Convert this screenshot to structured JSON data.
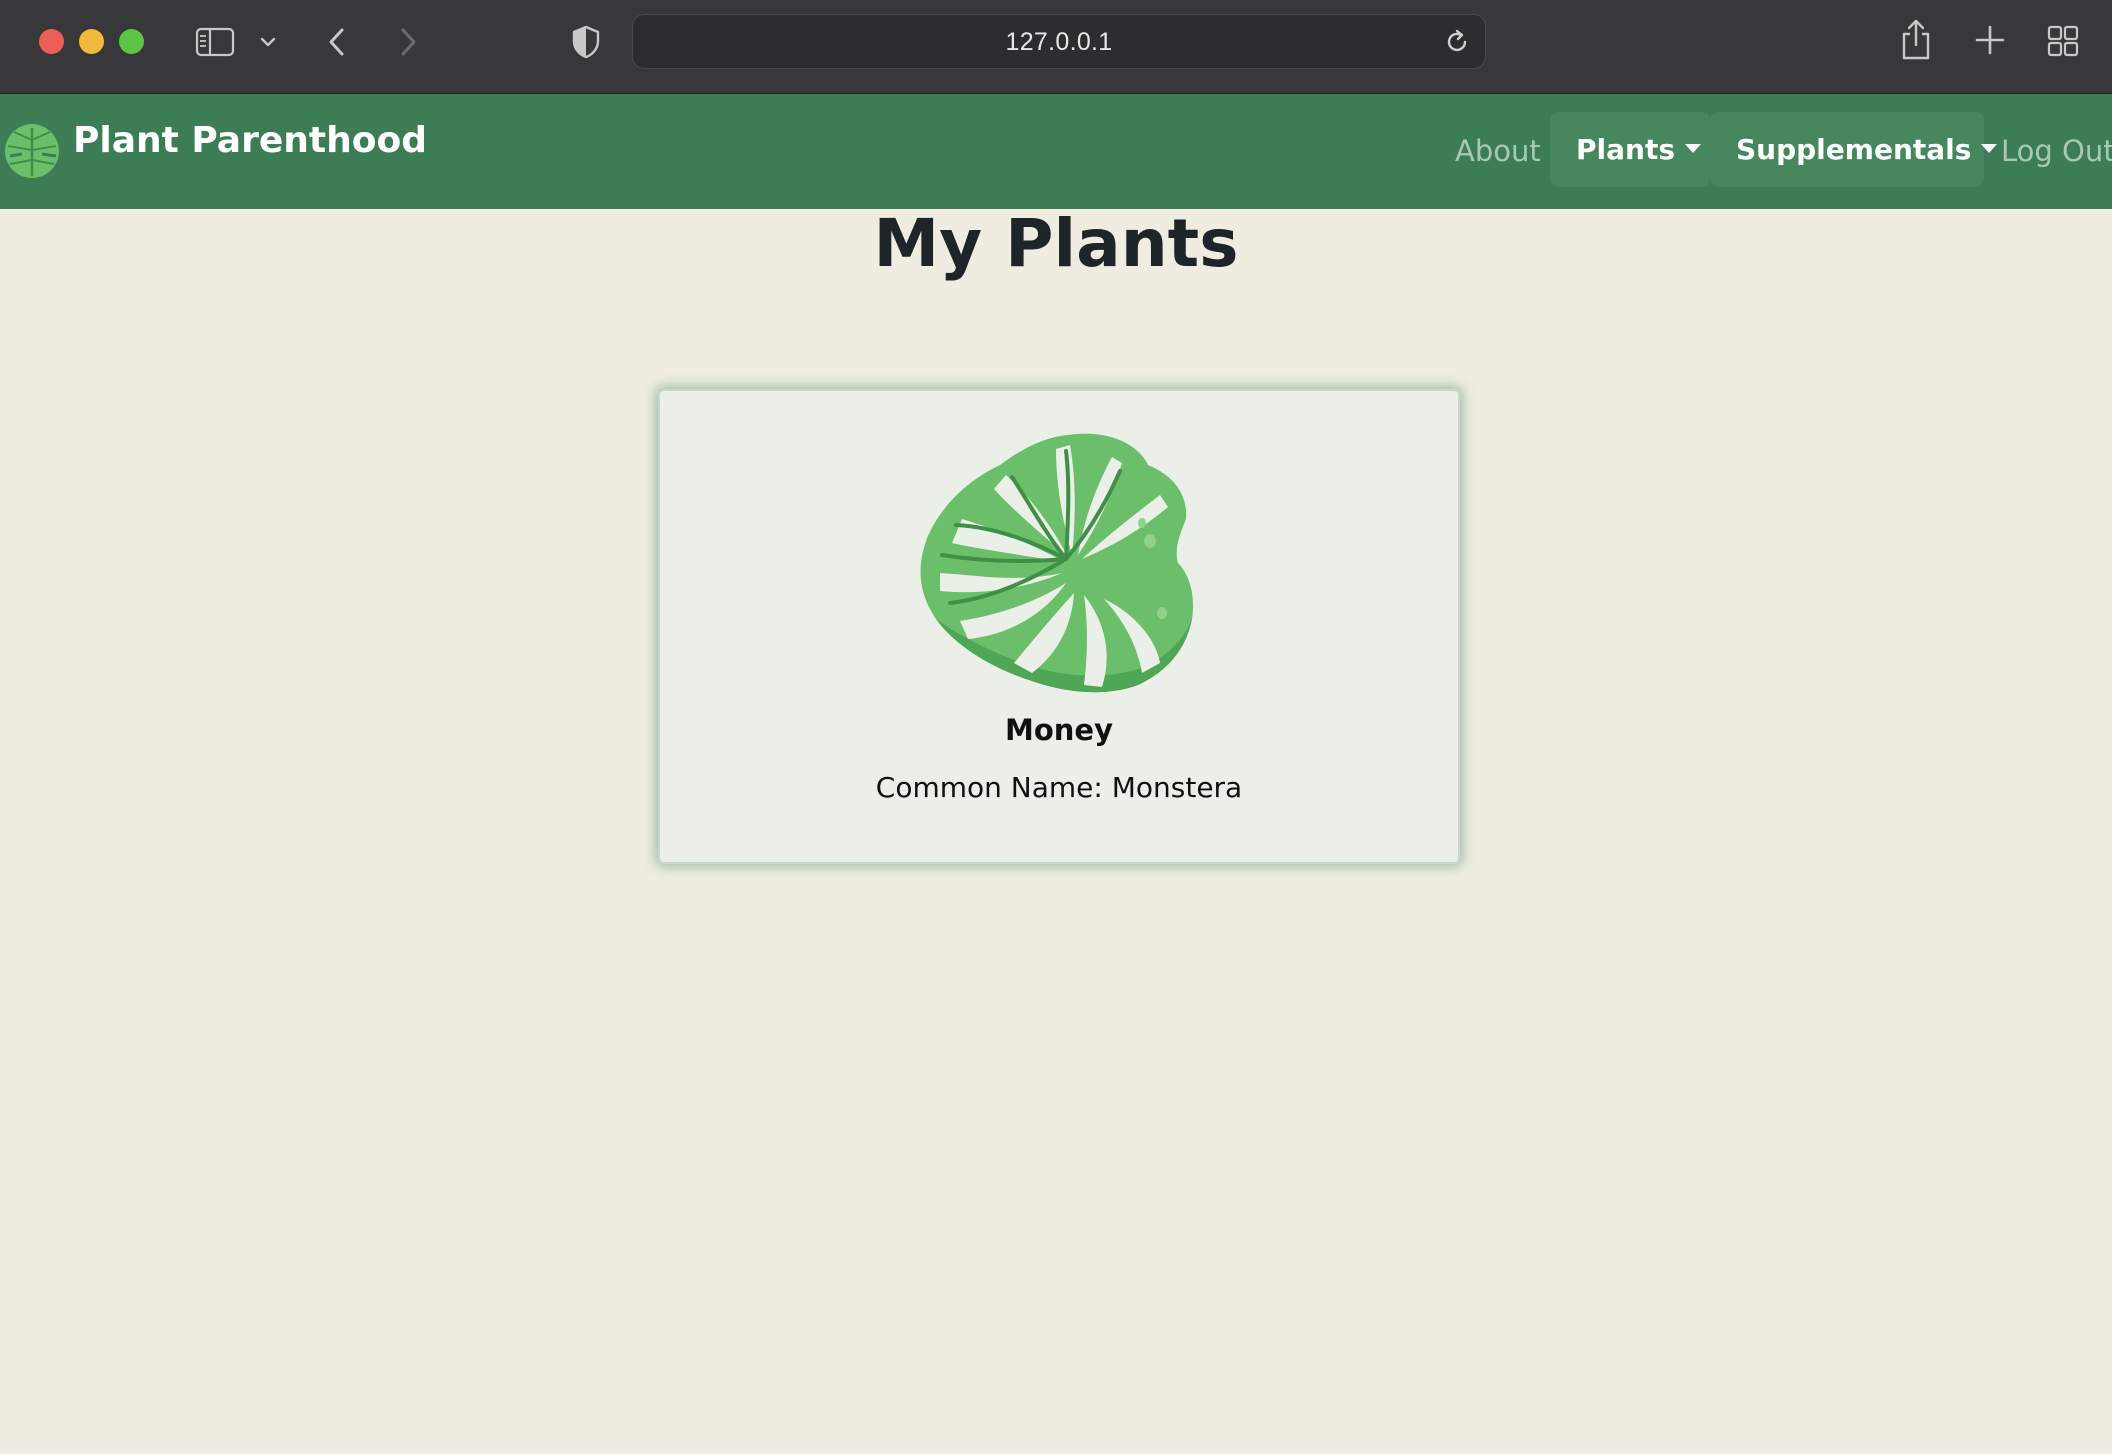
{
  "browser": {
    "address": "127.0.0.1"
  },
  "navbar": {
    "brand": "Plant Parenthood",
    "about": "About",
    "plants": "Plants",
    "supplementals": "Supplementals",
    "logout": "Log Out"
  },
  "page": {
    "title": "My Plants"
  },
  "plants": [
    {
      "name": "Money",
      "common_name": "Common Name: Monstera",
      "icon": "monstera-leaf-icon"
    }
  ],
  "colors": {
    "navbar": "#3d7d55",
    "nav_pill": "#47875d",
    "page_bg": "#efede2",
    "card_bg": "#eaefe8",
    "leaf_light": "#6cbf6a",
    "leaf_dark": "#3f8f47"
  }
}
